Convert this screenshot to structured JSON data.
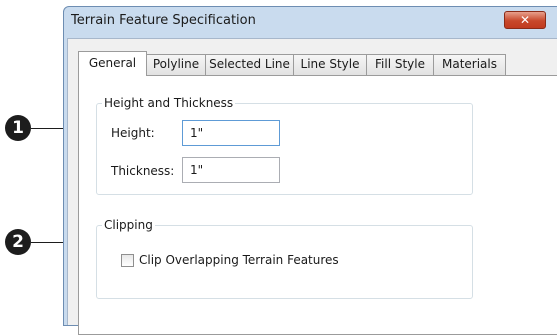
{
  "window": {
    "title": "Terrain Feature Specification",
    "close_glyph": "✕"
  },
  "tabs": [
    "General",
    "Polyline",
    "Selected Line",
    "Line Style",
    "Fill Style",
    "Materials"
  ],
  "active_tab": "General",
  "height_group": {
    "label": "Height and Thickness",
    "height_label": "Height:",
    "height_value": "1\"",
    "thickness_label": "Thickness:",
    "thickness_value": "1\""
  },
  "clipping_group": {
    "label": "Clipping",
    "clip_label": "Clip Overlapping Terrain Features",
    "clip_checked": false
  },
  "callouts": [
    "1",
    "2"
  ]
}
